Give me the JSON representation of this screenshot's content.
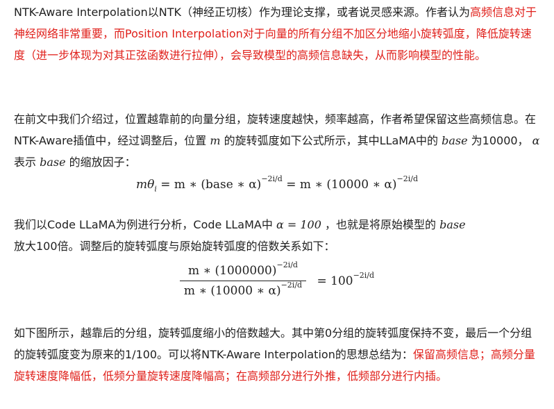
{
  "p1": {
    "a": "NTK-Aware Interpolation以NTK（神经正切核）作为理论支撑，或者说灵感来源。作者认为",
    "b": "高频信息对于神经网络非常重要，而Position Interpolation对于向量的所有分组不加区分地缩小旋转弧度，降低旋转速度（进一步体现为对其正弦函数进行拉伸），会导致模型的高频信息缺失，从而影响模型的性能。"
  },
  "p2": {
    "a": "在前文中我们介绍过，位置越靠前的向量分组，旋转速度越快，频率越高，作者希望保留这些高频信息。在NTK-Aware插值中，经过调整后，位置",
    "m": "m",
    "b": "的旋转弧度如下公式所示，其中LLaMA中的",
    "base1": "base",
    "c": "为10000，",
    "alpha": "α",
    "d": "表示",
    "base2": "base",
    "e": "的缩放因子："
  },
  "eq1": {
    "lhs": "mθ",
    "sub": "i",
    "mid1": " = m ∗ (base ∗ α)",
    "exp": "−2i/d",
    "mid2": " = m ∗ (10000 ∗ α)"
  },
  "p3": {
    "a": "我们以Code LLaMA为例进行分析，Code LLaMA中",
    "formula": "α = 100",
    "b": "，也就是将原始模型的",
    "base": "base",
    "c": "放大100倍。调整后的旋转弧度与原始旋转弧度的倍数关系如下："
  },
  "eq2": {
    "num": "m ∗ (1000000)",
    "den": "m ∗ (10000 ∗ α)",
    "exp": "−2i/d",
    "rhs": "= 100"
  },
  "p4": {
    "a": "如下图所示，越靠后的分组，旋转弧度缩小的倍数越大。其中第0分组的旋转弧度保持不变，最后一个分组的旋转弧度变为原来的1/100。可以将NTK-Aware Interpolation的思想总结为：",
    "b": "保留高频信息；高频分量旋转速度降幅低，低频分量旋转速度降幅高；在高频部分进行外推，低频部分进行内插。"
  }
}
